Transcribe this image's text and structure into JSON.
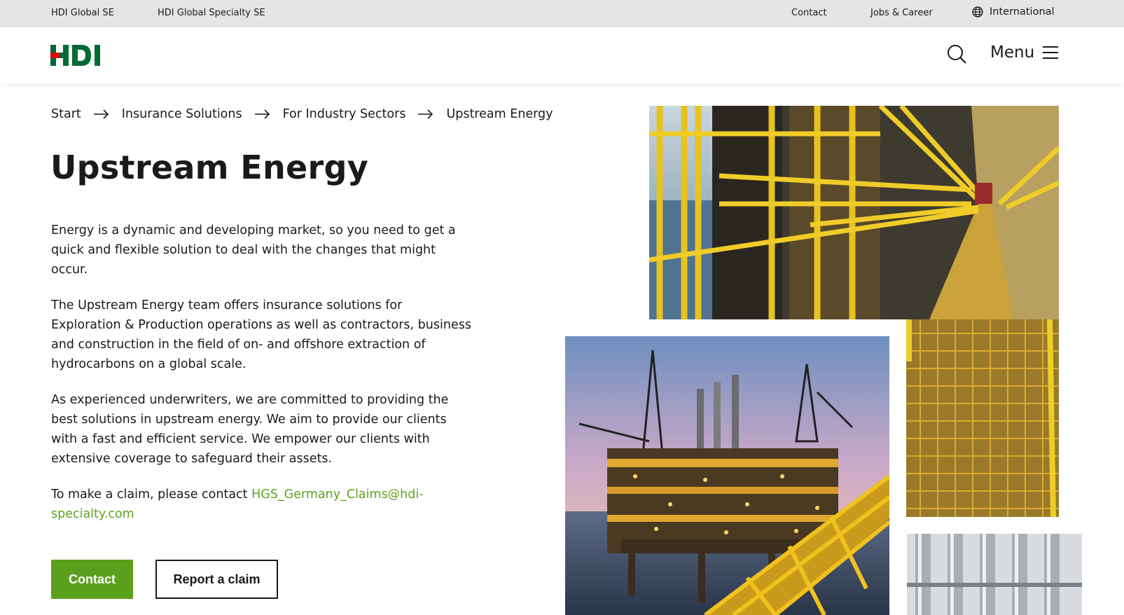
{
  "topbar": {
    "link1": "HDI Global SE",
    "link2": "HDI Global Specialty SE",
    "contact": "Contact",
    "jobs": "Jobs & Career",
    "international": "International",
    "international_icon": "globe-icon"
  },
  "header": {
    "logo_text": "HDI",
    "menu_label": "Menu",
    "search_icon": "search-icon",
    "menu_icon": "hamburger-icon"
  },
  "breadcrumb": [
    "Start",
    "Insurance Solutions",
    "For Industry Sectors",
    "Upstream Energy"
  ],
  "page": {
    "title": "Upstream Energy",
    "para1": "Energy is a dynamic and developing market, so you need to get a quick and flexible solution to deal with the changes that might occur.",
    "para2": "The Upstream Energy team offers insurance solutions for Exploration & Production operations as well as contractors, business and construction in the field of on- and offshore extraction of hydrocarbons on a global scale.",
    "para3": "As experienced underwriters, we are committed to providing the best solutions in upstream energy. We aim to provide our clients with a fast and efficient service.  We empower our clients with extensive coverage to safeguard their assets.",
    "claim_prefix": "To make a claim, please contact ",
    "claim_email": "HGS_Germany_Claims@hdi-specialty.com"
  },
  "buttons": {
    "contact": "Contact",
    "report_claim": "Report a claim"
  },
  "colors": {
    "brand_green": "#5c9f1c",
    "logo_red": "#e30613",
    "logo_green": "#006a32",
    "topbar_bg": "#e5e5e5"
  }
}
